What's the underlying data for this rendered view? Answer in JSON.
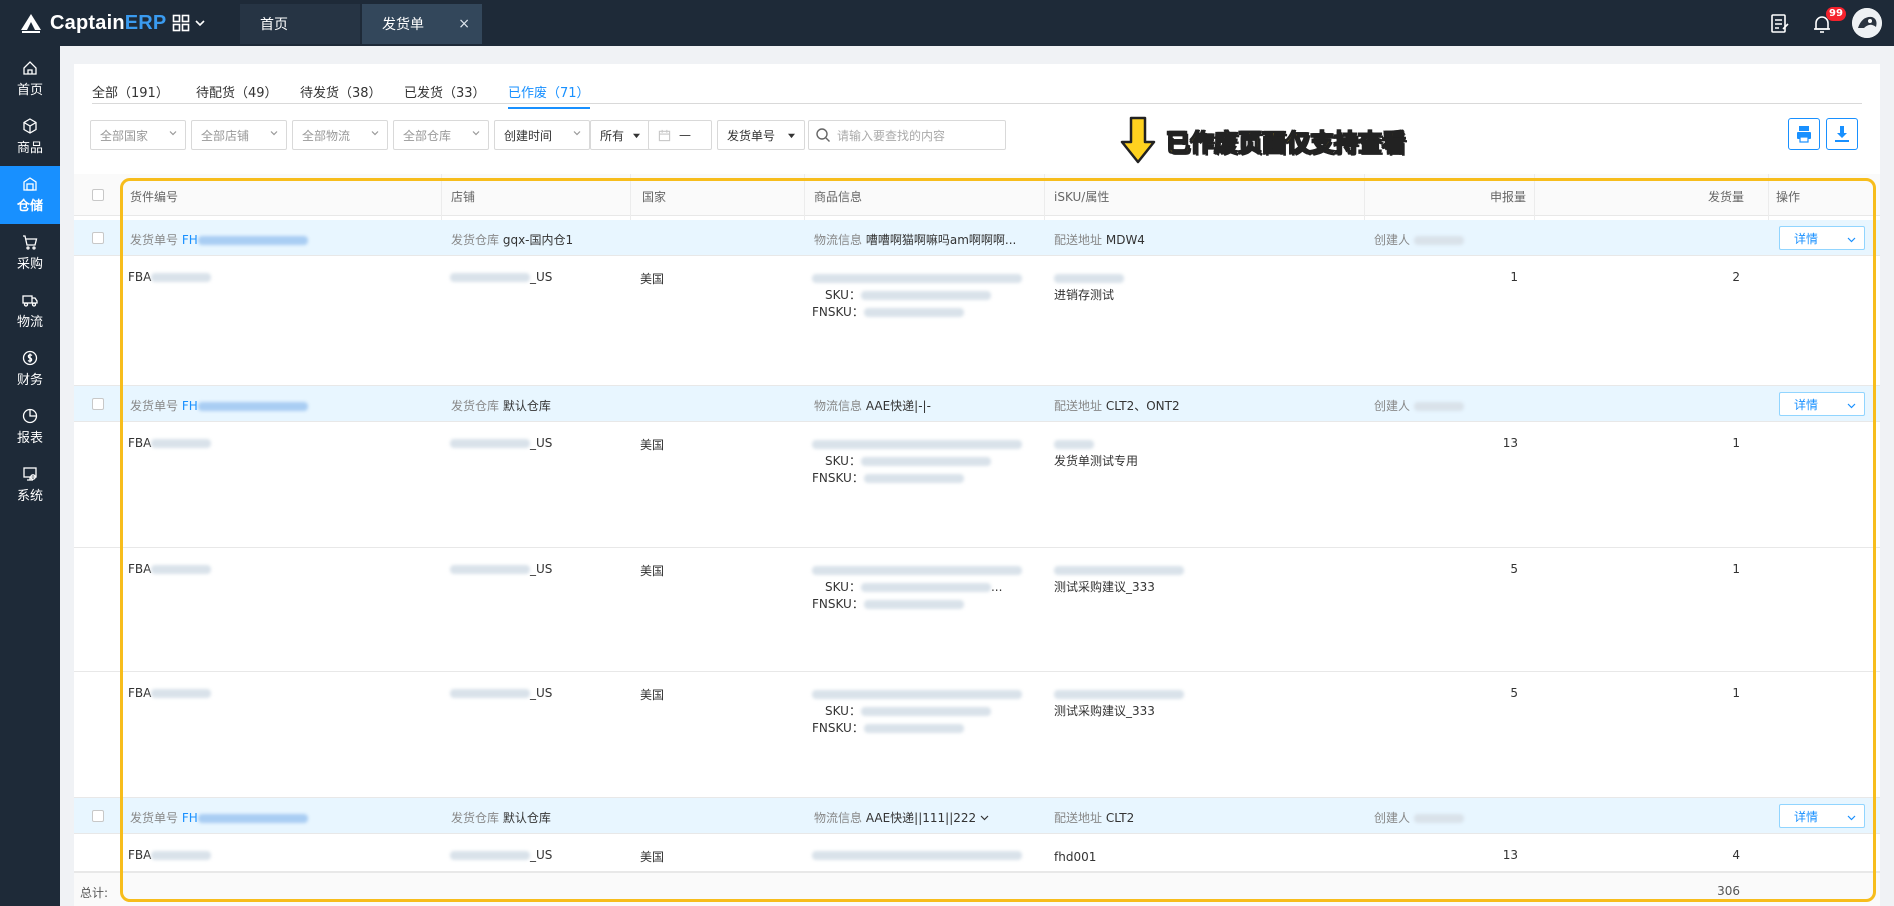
{
  "app": {
    "brand_a": "Captain",
    "brand_b": "ERP",
    "notification_count": "99",
    "colors": {
      "topbar": "#1e2a38",
      "accent": "#1890ff",
      "highlight": "#f7bd1c"
    }
  },
  "tabs": {
    "home": "首页",
    "active": "发货单",
    "close": "×"
  },
  "sidebar": {
    "items": [
      {
        "label": "首页",
        "icon": "home-icon"
      },
      {
        "label": "商品",
        "icon": "box-icon"
      },
      {
        "label": "仓储",
        "icon": "warehouse-icon"
      },
      {
        "label": "采购",
        "icon": "cart-icon"
      },
      {
        "label": "物流",
        "icon": "truck-icon"
      },
      {
        "label": "财务",
        "icon": "money-icon"
      },
      {
        "label": "报表",
        "icon": "report-icon"
      },
      {
        "label": "系统",
        "icon": "system-icon"
      }
    ]
  },
  "status_tabs": [
    "全部（191）",
    "待配货（49）",
    "待发货（38）",
    "已发货（33）",
    "已作废（71）"
  ],
  "filters": {
    "country": "全部国家",
    "store": "全部店铺",
    "logistics": "全部物流",
    "warehouse": "全部仓库",
    "time_type": "创建时间",
    "time_range": "所有",
    "date_sep": "—",
    "search_type": "发货单号",
    "search_placeholder": "请输入要查找的内容"
  },
  "hint": "已作废页面仅支持查看",
  "table": {
    "headers": {
      "cargo_no": "货件编号",
      "store": "店铺",
      "country": "国家",
      "product": "商品信息",
      "isku": "iSKU/属性",
      "declared": "申报量",
      "shipped": "发货量",
      "action": "操作"
    },
    "labels": {
      "order_no": "发货单号",
      "warehouse": "发货仓库",
      "logistics": "物流信息",
      "address": "配送地址",
      "creator": "创建人",
      "sku": "SKU：",
      "fnsku": "FNSKU：",
      "detail": "详情"
    },
    "groups": [
      {
        "order_prefix": "FH",
        "warehouse": "gqx-国内仓1",
        "logistics": "嘈嘈啊猫啊嘛吗am啊啊啊...",
        "address": "MDW4",
        "rows": [
          {
            "cargo_prefix": "FBA",
            "store_suffix": "_US",
            "country": "美国",
            "attr": "进销存测试",
            "declared": "1",
            "shipped": "2",
            "sku_suffix": ""
          }
        ]
      },
      {
        "order_prefix": "FH",
        "warehouse": "默认仓库",
        "logistics": "AAE快递|-|-",
        "address": "CLT2、ONT2",
        "rows": [
          {
            "cargo_prefix": "FBA",
            "store_suffix": "_US",
            "country": "美国",
            "attr": "发货单测试专用",
            "declared": "13",
            "shipped": "1",
            "sku_suffix": ""
          },
          {
            "cargo_prefix": "FBA",
            "store_suffix": "_US",
            "country": "美国",
            "attr": "测试采购建议_333",
            "declared": "5",
            "shipped": "1",
            "sku_suffix": "..."
          },
          {
            "cargo_prefix": "FBA",
            "store_suffix": "_US",
            "country": "美国",
            "attr": "测试采购建议_333",
            "declared": "5",
            "shipped": "1",
            "sku_suffix": ""
          }
        ]
      },
      {
        "order_prefix": "FH",
        "warehouse": "默认仓库",
        "logistics": "AAE快递||111||222",
        "address": "CLT2",
        "rows": [
          {
            "cargo_prefix": "FBA",
            "store_suffix": "_US",
            "country": "美国",
            "attr": "fhd001",
            "declared": "13",
            "shipped": "4",
            "sku_suffix": ""
          }
        ]
      }
    ],
    "footer": {
      "label": "总计:",
      "shipped_total": "306"
    }
  }
}
